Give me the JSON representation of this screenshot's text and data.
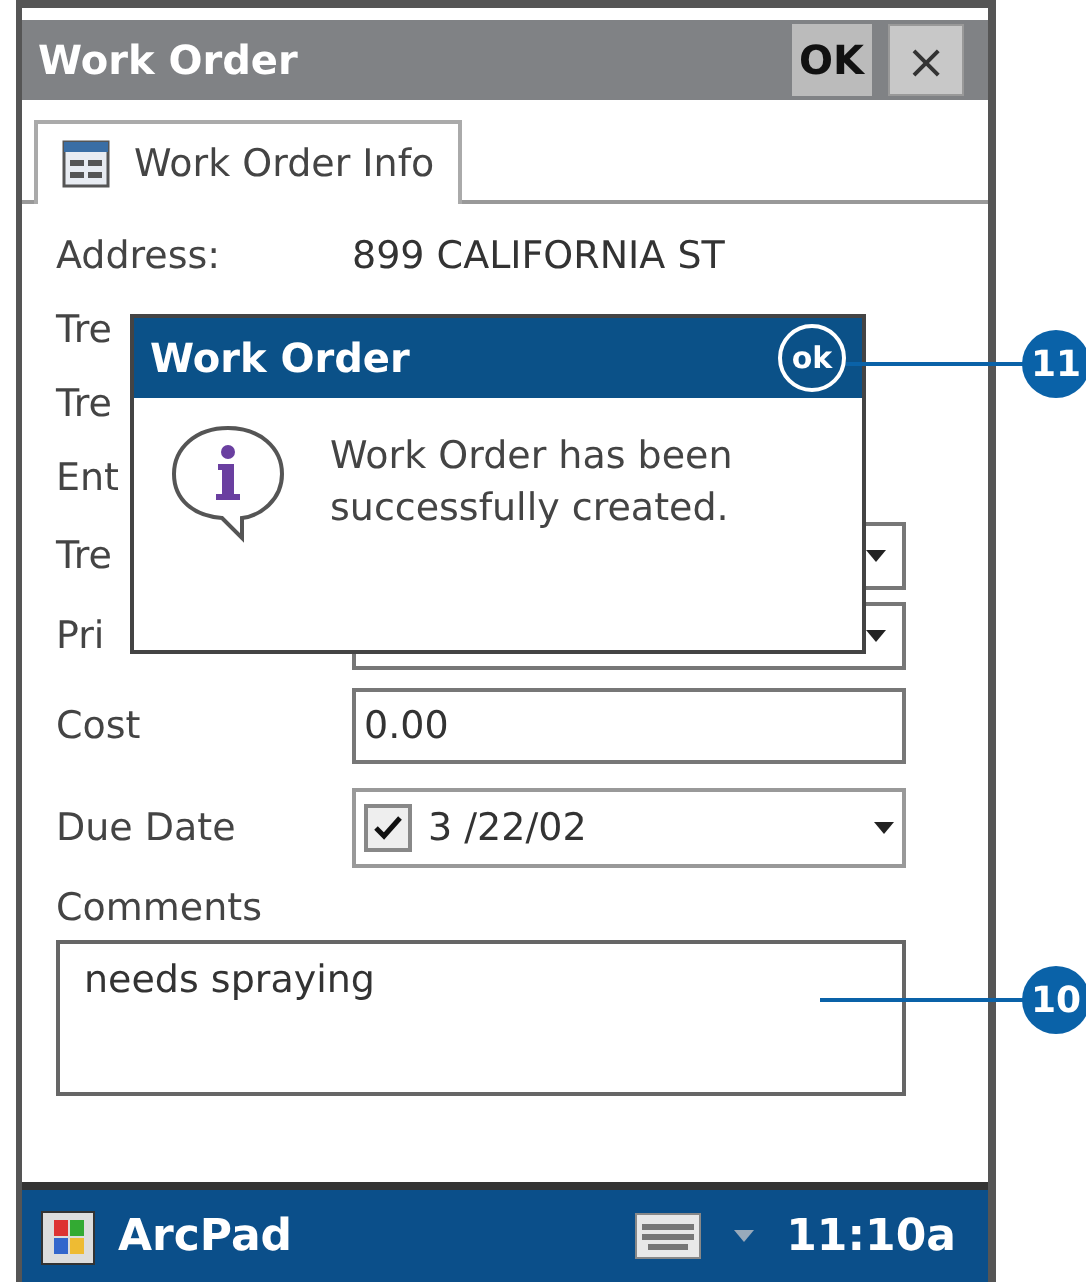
{
  "title_bar": {
    "title": "Work Order",
    "ok_button": "OK",
    "close_button": "×"
  },
  "tabs": [
    {
      "label": "Work Order Info",
      "selected": true
    }
  ],
  "fields": [
    {
      "kind": "static",
      "label": "Address:",
      "value": "899 CALIFORNIA ST"
    },
    {
      "kind": "static",
      "label": "Tre"
    },
    {
      "kind": "static",
      "label": "Tre"
    },
    {
      "kind": "static",
      "label": "Ent"
    },
    {
      "kind": "dropdown",
      "label": "Tre"
    },
    {
      "kind": "dropdown",
      "label": "Pri"
    },
    {
      "kind": "input",
      "label": "Cost",
      "value": "0.00"
    },
    {
      "kind": "date",
      "label": "Due Date",
      "value": "3 /22/02",
      "checked": true
    }
  ],
  "comments": {
    "label": "Comments",
    "value": "needs spraying"
  },
  "dialog": {
    "title": "Work Order",
    "ok_button": "ok",
    "message": "Work Order has been successfully created."
  },
  "taskbar": {
    "app": "ArcPad",
    "time": "11:10a"
  },
  "callouts": [
    "11",
    "10"
  ]
}
